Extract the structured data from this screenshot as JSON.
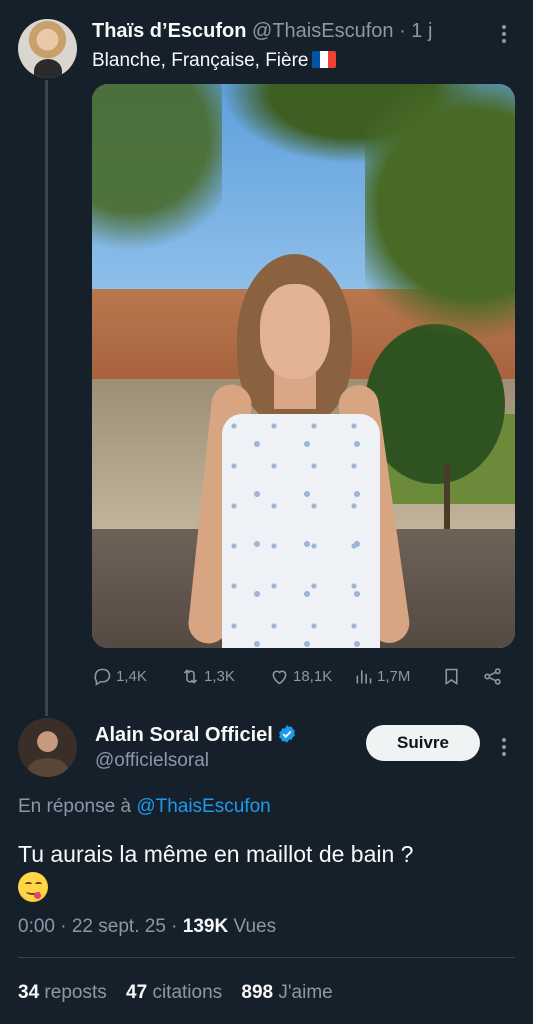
{
  "original_tweet": {
    "name": "Thaïs d’Escufon",
    "handle": "@ThaisEscufon",
    "time": "· 1 j",
    "text": "Blanche, Française, Fière",
    "flag_colors": [
      "#0055a4",
      "#ffffff",
      "#ef4135"
    ],
    "actions": {
      "replies": "1,4K",
      "reposts": "1,3K",
      "likes": "18,1K",
      "views": "1,7M"
    }
  },
  "reply": {
    "name": "Alain Soral Officiel",
    "handle": "@officielsoral",
    "follow_label": "Suivre",
    "in_reply_prefix": "En réponse à",
    "in_reply_handle": "@ThaisEscufon",
    "text": "Tu aurais la même en maillot de bain ?",
    "time": "0:00 · 22 sept. 25 ·",
    "views_count": "139K",
    "views_label": "Vues",
    "stats": {
      "reposts_count": "34",
      "reposts_label": "reposts",
      "quotes_count": "47",
      "quotes_label": "citations",
      "likes_count": "898",
      "likes_label": "J'aime"
    }
  },
  "colors": {
    "background": "#15202b",
    "accent": "#1d9bf0",
    "muted": "#8b98a5",
    "text": "#f7f9f9"
  }
}
